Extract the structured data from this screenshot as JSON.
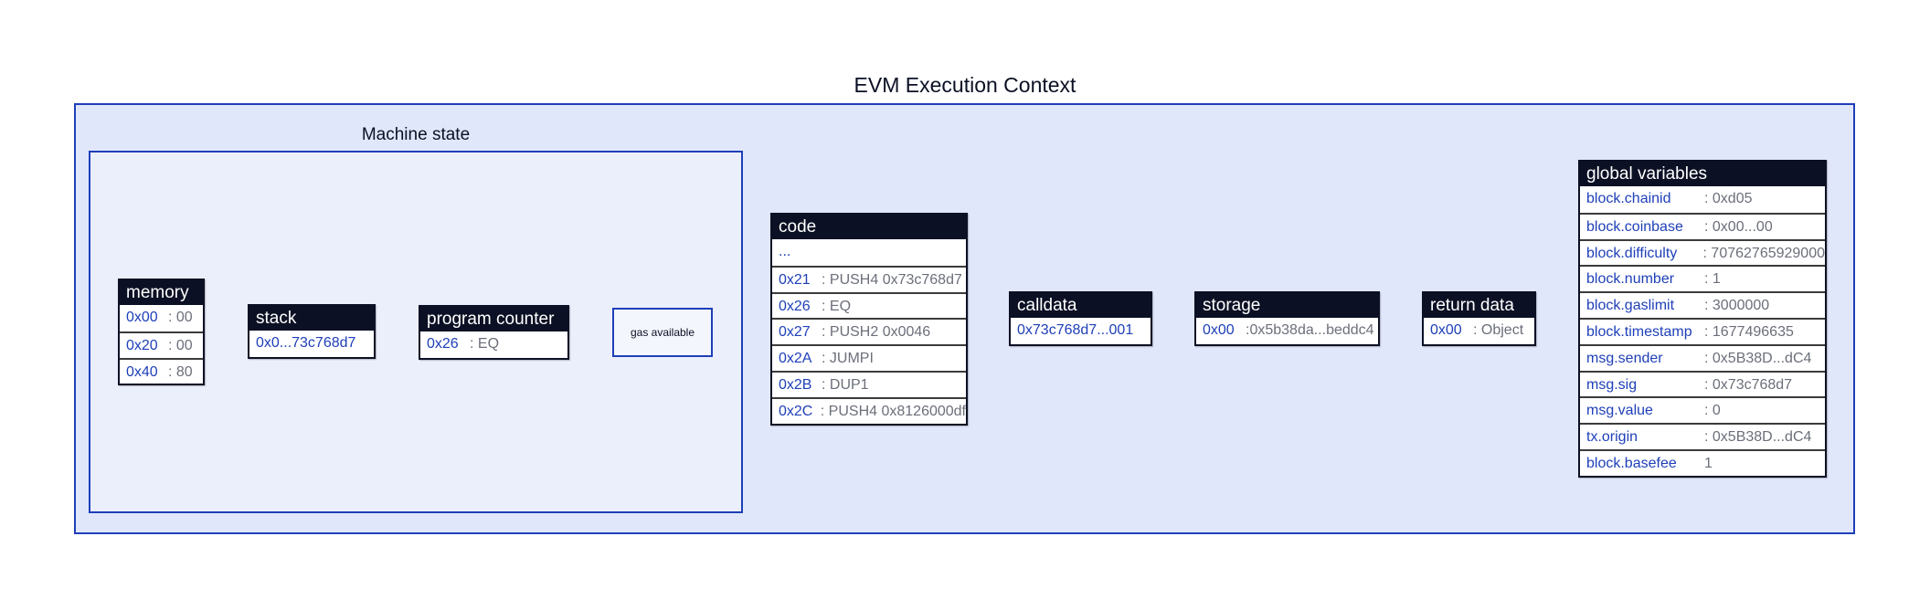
{
  "title": "EVM Execution Context",
  "machine_state": {
    "title": "Machine state",
    "memory": {
      "header": "memory",
      "rows": [
        {
          "key": "0x00",
          "value": ": 00"
        },
        {
          "key": "0x20",
          "value": ": 00"
        },
        {
          "key": "0x40",
          "value": ": 80"
        }
      ]
    },
    "stack": {
      "header": "stack",
      "rows": [
        {
          "key": "0x0...73c768d7",
          "value": ""
        }
      ]
    },
    "program_counter": {
      "header": "program counter",
      "rows": [
        {
          "key": "0x26",
          "value": ": EQ"
        }
      ]
    },
    "gas": {
      "label": "gas available"
    }
  },
  "code": {
    "header": "code",
    "rows": [
      {
        "key": "...",
        "value": ""
      },
      {
        "key": "0x21",
        "value": ": PUSH4 0x73c768d7"
      },
      {
        "key": "0x26",
        "value": ": EQ"
      },
      {
        "key": "0x27",
        "value": ": PUSH2 0x0046"
      },
      {
        "key": "0x2A",
        "value": ": JUMPI"
      },
      {
        "key": "0x2B",
        "value": ": DUP1"
      },
      {
        "key": "0x2C",
        "value": ": PUSH4 0x8126000df"
      }
    ]
  },
  "calldata": {
    "header": "calldata",
    "rows": [
      {
        "key": "0x73c768d7...001",
        "value": ""
      }
    ]
  },
  "storage": {
    "header": "storage",
    "rows": [
      {
        "key": "0x00",
        "value": ":0x5b38da...beddc4"
      }
    ]
  },
  "return_data": {
    "header": "return data",
    "rows": [
      {
        "key": "0x00",
        "value": ": Object"
      }
    ]
  },
  "global_variables": {
    "header": "global variables",
    "rows": [
      {
        "key": "block.chainid",
        "value": ": 0xd05"
      },
      {
        "key": "block.coinbase",
        "value": ": 0x00...00"
      },
      {
        "key": "block.difficulty",
        "value": ": 70762765929000"
      },
      {
        "key": "block.number",
        "value": ": 1"
      },
      {
        "key": "block.gaslimit",
        "value": ": 3000000"
      },
      {
        "key": "block.timestamp",
        "value": ": 1677496635"
      },
      {
        "key": "msg.sender",
        "value": ": 0x5B38D...dC4"
      },
      {
        "key": "msg.sig",
        "value": ": 0x73c768d7"
      },
      {
        "key": "msg.value",
        "value": ": 0"
      },
      {
        "key": "tx.origin",
        "value": ": 0x5B38D...dC4"
      },
      {
        "key": "block.basefee",
        "value": "1"
      }
    ]
  }
}
